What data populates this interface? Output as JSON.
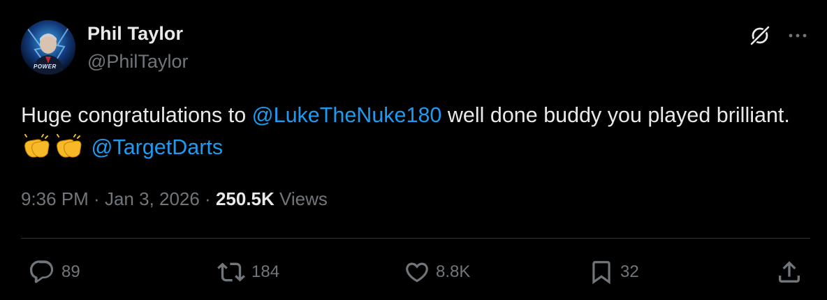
{
  "author": {
    "name": "Phil Taylor",
    "handle": "@PhilTaylor",
    "avatar_badge": "POWER"
  },
  "icons": {
    "grok": "grok-icon",
    "more": "more-options-icon",
    "reply": "reply-icon",
    "retweet": "retweet-icon",
    "like": "heart-icon",
    "bookmark": "bookmark-icon",
    "share": "share-icon",
    "clap": "clapping-hands-emoji"
  },
  "tweet": {
    "text_part1": "Huge congratulations to ",
    "mention1": "@LukeTheNuke180",
    "text_part2": " well done buddy you played brilliant. ",
    "mention2": "@TargetDarts"
  },
  "meta": {
    "time": "9:36 PM",
    "separator1": " · ",
    "date": "Jan 3, 2026",
    "separator2": " · ",
    "views_count": "250.5K",
    "views_label": " Views"
  },
  "actions": {
    "replies": "89",
    "retweets": "184",
    "likes": "8.8K",
    "bookmarks": "32"
  },
  "colors": {
    "background": "#000000",
    "text": "#e7e9ea",
    "secondary": "#71767b",
    "link": "#1d9bf0",
    "divider": "#2f3336"
  }
}
